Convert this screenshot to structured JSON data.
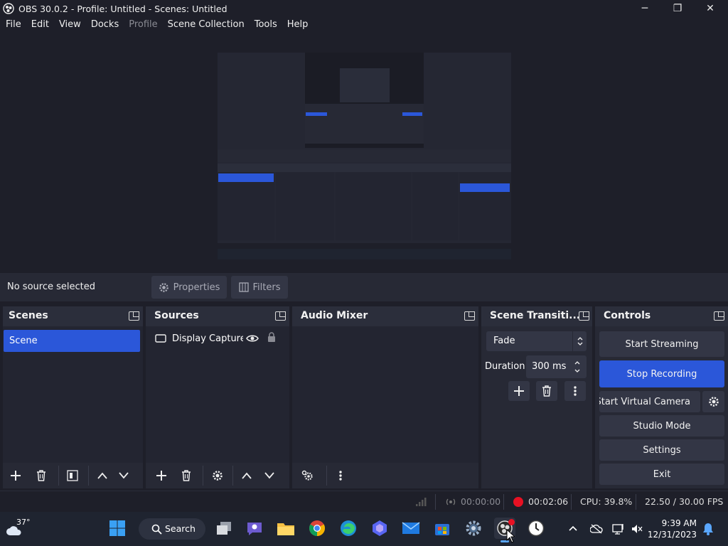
{
  "window": {
    "title": "OBS 30.0.2 - Profile: Untitled - Scenes: Untitled",
    "min_glyph": "─",
    "max_glyph": "❐",
    "close_glyph": "✕"
  },
  "menu": [
    "File",
    "Edit",
    "View",
    "Docks",
    "Profile",
    "Scene Collection",
    "Tools",
    "Help"
  ],
  "context_bar": {
    "status": "No source selected",
    "properties_label": "Properties",
    "filters_label": "Filters"
  },
  "scenes": {
    "title": "Scenes",
    "items": [
      "Scene"
    ]
  },
  "sources": {
    "title": "Sources",
    "items": [
      "Display Capture"
    ]
  },
  "audio_mixer": {
    "title": "Audio Mixer"
  },
  "transitions": {
    "title": "Scene Transiti...",
    "selected": "Fade",
    "duration_label": "Duration",
    "duration_value": "300 ms"
  },
  "controls": {
    "title": "Controls",
    "start_streaming": "Start Streaming",
    "stop_recording": "Stop Recording",
    "start_virtual_camera": "Start Virtual Camera",
    "studio_mode": "Studio Mode",
    "settings": "Settings",
    "exit": "Exit"
  },
  "status": {
    "stream_time": "00:00:00",
    "rec_time": "00:02:06",
    "cpu": "CPU: 39.8%",
    "fps": "22.50 / 30.00 FPS"
  },
  "taskbar": {
    "weather_temp": "37°",
    "search_label": "Search",
    "time": "9:39 AM",
    "date": "12/31/2023"
  },
  "colors": {
    "accent": "#2b57d9",
    "background": "#1e1f29",
    "dock": "#272935",
    "record_red": "#e81123"
  }
}
